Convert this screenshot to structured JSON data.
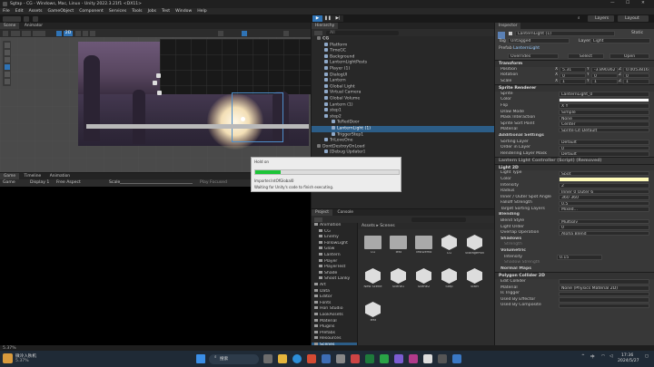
{
  "window": {
    "title": "Sgtap - CG - Windows, Mac, Linux - Unity 2022.3.21f1 <DX11>"
  },
  "menu": [
    "File",
    "Edit",
    "Assets",
    "GameObject",
    "Component",
    "Services",
    "Tools",
    "Jobs",
    "Test",
    "Window",
    "Help"
  ],
  "toolbar": {
    "layers": "Layers",
    "layout": "Layout"
  },
  "scene": {
    "tabs": [
      "Scene",
      "Animator"
    ],
    "view2d": "2D"
  },
  "game": {
    "tabs": [
      "Game",
      "Timeline",
      "Animation"
    ],
    "display": "Game",
    "display_num": "Display 1",
    "aspect": "Free Aspect",
    "scale": "Scale",
    "scale_val": "1x",
    "play_mode": "Play Focused"
  },
  "hierarchy": {
    "tab": "Hierarchy",
    "search": "All",
    "items": [
      {
        "label": "CG",
        "indent": 0,
        "bold": true
      },
      {
        "label": "Platform",
        "indent": 1
      },
      {
        "label": "TimeGC",
        "indent": 1
      },
      {
        "label": "Background",
        "indent": 1
      },
      {
        "label": "LanternLightPosts",
        "indent": 1
      },
      {
        "label": "Player (1)",
        "indent": 1
      },
      {
        "label": "DialogUI",
        "indent": 1
      },
      {
        "label": "Lantern",
        "indent": 1
      },
      {
        "label": "Global Light",
        "indent": 1
      },
      {
        "label": "Virtual Camera",
        "indent": 1
      },
      {
        "label": "Global Volume",
        "indent": 1
      },
      {
        "label": "Lantern (1)",
        "indent": 1
      },
      {
        "label": "step1",
        "indent": 1
      },
      {
        "label": "step2",
        "indent": 1
      },
      {
        "label": "TeRedDoor",
        "indent": 2
      },
      {
        "label": "LanternLight (1)",
        "indent": 2,
        "selected": true
      },
      {
        "label": "TriggerStep1",
        "indent": 2
      },
      {
        "label": "TriLoveOne",
        "indent": 1
      },
      {
        "label": "DontDestroyOnLoad",
        "indent": 0
      },
      {
        "label": "[Debug Updater]",
        "indent": 1
      }
    ]
  },
  "progress": {
    "title": "Hold on",
    "task": "Importer.IntOfGlobal0",
    "message": "Waiting for Unity's code to finish executing.",
    "value": 0.18
  },
  "project": {
    "tabs": [
      "Project",
      "Console"
    ],
    "breadcrumb": [
      "Assets",
      "Scenes"
    ],
    "tree": [
      {
        "label": "Animation",
        "indent": 0
      },
      {
        "label": "CG",
        "indent": 1
      },
      {
        "label": "Enemy",
        "indent": 1
      },
      {
        "label": "FollowLight",
        "indent": 1
      },
      {
        "label": "Glow",
        "indent": 1
      },
      {
        "label": "Lantern",
        "indent": 1
      },
      {
        "label": "Player",
        "indent": 1
      },
      {
        "label": "PlayerTest",
        "indent": 1
      },
      {
        "label": "Shade",
        "indent": 1
      },
      {
        "label": "Shoot Lanky",
        "indent": 1
      },
      {
        "label": "Art",
        "indent": 0
      },
      {
        "label": "Data",
        "indent": 0
      },
      {
        "label": "Editor",
        "indent": 0
      },
      {
        "label": "Fonts",
        "indent": 0
      },
      {
        "label": "Hori Studio",
        "indent": 0
      },
      {
        "label": "LookAssets",
        "indent": 0
      },
      {
        "label": "Material",
        "indent": 0
      },
      {
        "label": "Plugins",
        "indent": 0
      },
      {
        "label": "Prefabs",
        "indent": 0
      },
      {
        "label": "Resources",
        "indent": 0
      },
      {
        "label": "Scenes",
        "indent": 0,
        "selected": true
      },
      {
        "label": "Scripts",
        "indent": 0
      },
      {
        "label": "Lantern",
        "indent": 1
      },
      {
        "label": "Light",
        "indent": 1
      },
      {
        "label": "Looping",
        "indent": 1
      }
    ],
    "assets": [
      {
        "label": "CG",
        "kind": "folder"
      },
      {
        "label": "Test",
        "kind": "folder"
      },
      {
        "label": "TestDemo",
        "kind": "folder"
      },
      {
        "label": "CG",
        "kind": "scene"
      },
      {
        "label": "StoragePlot",
        "kind": "scene"
      },
      {
        "label": "New Scene",
        "kind": "scene"
      },
      {
        "label": "Scene1",
        "kind": "scene"
      },
      {
        "label": "Scene2",
        "kind": "scene"
      },
      {
        "label": "Step",
        "kind": "scene"
      },
      {
        "label": "Start",
        "kind": "scene"
      },
      {
        "label": "Test",
        "kind": "scene"
      }
    ]
  },
  "inspector": {
    "tab": "Inspector",
    "object": "LanternLight (1)",
    "static": "Static",
    "tag_label": "Tag",
    "tag": "Untagged",
    "layer_label": "Layer",
    "layer": "Light",
    "prefab_label": "Prefab",
    "prefab": "LanternLight",
    "overrides": "Overrides",
    "select": "Select",
    "open": "Open",
    "transform": {
      "title": "Transform",
      "rows": [
        {
          "label": "Position",
          "x": "5.31",
          "y": "-3.890362",
          "z": "0.0053816"
        },
        {
          "label": "Rotation",
          "x": "0",
          "y": "0",
          "z": "0"
        },
        {
          "label": "Scale",
          "x": "1",
          "y": "1",
          "z": "1"
        }
      ]
    },
    "sprite": {
      "title": "Sprite Renderer",
      "rows": [
        {
          "label": "Sprite",
          "value": "LanternLight_0"
        },
        {
          "label": "Color",
          "value": ""
        },
        {
          "label": "Flip",
          "value": "X  Y"
        },
        {
          "label": "Draw Mode",
          "value": "Simple"
        },
        {
          "label": "Mask Interaction",
          "value": "None"
        },
        {
          "label": "Sprite Sort Point",
          "value": "Center"
        },
        {
          "label": "Material",
          "value": "Sprite-Lit-Default"
        }
      ],
      "additional": "Additional Settings",
      "rows2": [
        {
          "label": "Sorting Layer",
          "value": "Default"
        },
        {
          "label": "Order in Layer",
          "value": "0"
        },
        {
          "label": "Rendering Layer Mask",
          "value": "Default"
        }
      ]
    },
    "script": "Lantern Light Controller (Script) (Removed)",
    "light": {
      "title": "Light 2D",
      "rows": [
        {
          "label": "Light Type",
          "value": "Spot"
        },
        {
          "label": "Color",
          "value": ""
        },
        {
          "label": "Intensity",
          "value": "2"
        },
        {
          "label": "Radius",
          "value": "Inner  0     Outer  6"
        },
        {
          "label": "Inner / Outer Spot Angle",
          "value": "360     360"
        },
        {
          "label": "Falloff Strength",
          "value": "0.5"
        },
        {
          "label": "Target Sorting Layers",
          "value": "Mixed..."
        }
      ],
      "blending": "Blending",
      "rows2": [
        {
          "label": "Blend Style",
          "value": "Multiply"
        },
        {
          "label": "Light Order",
          "value": "0"
        },
        {
          "label": "Overlap Operation",
          "value": "Alpha Blend"
        }
      ],
      "shadows": "Shadows",
      "strength": "Strength",
      "volumetric": "Volumetric",
      "vintensity": "Intensity",
      "vint_val": "0.15",
      "vstrength": "Shadow Strength",
      "normal": "Normal Maps"
    },
    "collider": {
      "title": "Polygon Collider 2D",
      "rows": [
        {
          "label": "Edit Collider",
          "value": ""
        },
        {
          "label": "Material",
          "value": "None (Physics Material 2D)"
        },
        {
          "label": "Is Trigger",
          "value": ""
        },
        {
          "label": "Used By Effector",
          "value": ""
        },
        {
          "label": "Used By Composite",
          "value": ""
        }
      ]
    }
  },
  "status": {
    "text": "5.37%"
  },
  "taskbar": {
    "weather": "微冷入秋机",
    "weather_sub": "5.37%",
    "search": "搜索",
    "lang": "中",
    "time": "17:36",
    "date": "2024/5/27"
  },
  "colors": {
    "accent": "#2c5d87",
    "selected": "#2c5d87",
    "progress": "#1cc437",
    "light_color": "#fffbb8"
  }
}
